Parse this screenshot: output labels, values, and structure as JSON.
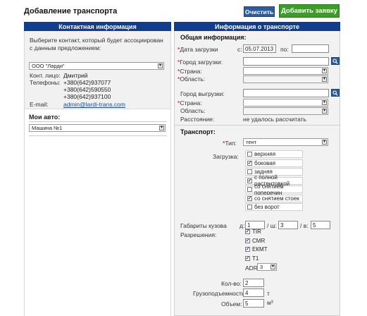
{
  "page": {
    "title": "Добавление транспорта"
  },
  "toolbar": {
    "clear_label": "Очистить",
    "add_label": "Добавить заявку"
  },
  "headers": {
    "contact": "Контактная информация",
    "transport": "Информация о транспорте"
  },
  "contact": {
    "hint": "Выберите контакт, который будет ассоциирован с данным предложением:",
    "company_selected": "ООО \"Ларди\"",
    "person_label": "Конт. лицо:",
    "person_value": "Дмитрий",
    "phones_label": "Телефоны:",
    "phones": [
      "+380(642)937077",
      "+380(642)590550",
      "+380(642)937100"
    ],
    "email_label": "E-mail:",
    "email": "admin@lardi-trans.com"
  },
  "my_autos": {
    "title": "Мои авто:",
    "selected": "Машина №1"
  },
  "general": {
    "title": "Общая информация:",
    "load_date_label": "Дата загрузки",
    "from_label": "с:",
    "from_value": "05.07.2013",
    "to_label": "по:",
    "to_value": "",
    "load_city_label": "Город загрузки:",
    "country_label": "Страна:",
    "region_label": "Область:",
    "unload_city_label": "Город выгрузки:",
    "country2_label": "Страна:",
    "region2_label": "Область:",
    "distance_label": "Расстояние:",
    "distance_value": "не удалось рассчитать"
  },
  "transport": {
    "title": "Транспорт:",
    "type_label": "Тип:",
    "type_value": "тент",
    "loading_label": "Загрузка:",
    "loading_options": [
      {
        "label": "верхняя",
        "checked": false
      },
      {
        "label": "боковая",
        "checked": true
      },
      {
        "label": "задняя",
        "checked": false
      },
      {
        "label": "с полной растентовкой",
        "checked": true
      },
      {
        "label": "со снятием поперечин",
        "checked": false
      },
      {
        "label": "со снятием стоек",
        "checked": true
      },
      {
        "label": "без ворот",
        "checked": false
      }
    ],
    "dims_label": "Габариты кузова",
    "d_label": "д:",
    "d_value": "1",
    "w_label": "/ ш:",
    "w_value": "3",
    "h_label": "/ в:",
    "h_value": "5",
    "permits_label": "Разрешения:",
    "permits": [
      {
        "label": "TIR",
        "checked": true
      },
      {
        "label": "CMR",
        "checked": true
      },
      {
        "label": "ЕКМТ",
        "checked": true
      },
      {
        "label": "T1",
        "checked": true
      }
    ],
    "adr_label": "ADR",
    "adr_value": "3",
    "count_label": "Кол-во:",
    "count_value": "2",
    "capacity_label": "Грузоподъемность:",
    "capacity_value": "4",
    "capacity_unit": "т",
    "volume_label": "Объем:",
    "volume_value": "5",
    "volume_unit": "м³"
  }
}
